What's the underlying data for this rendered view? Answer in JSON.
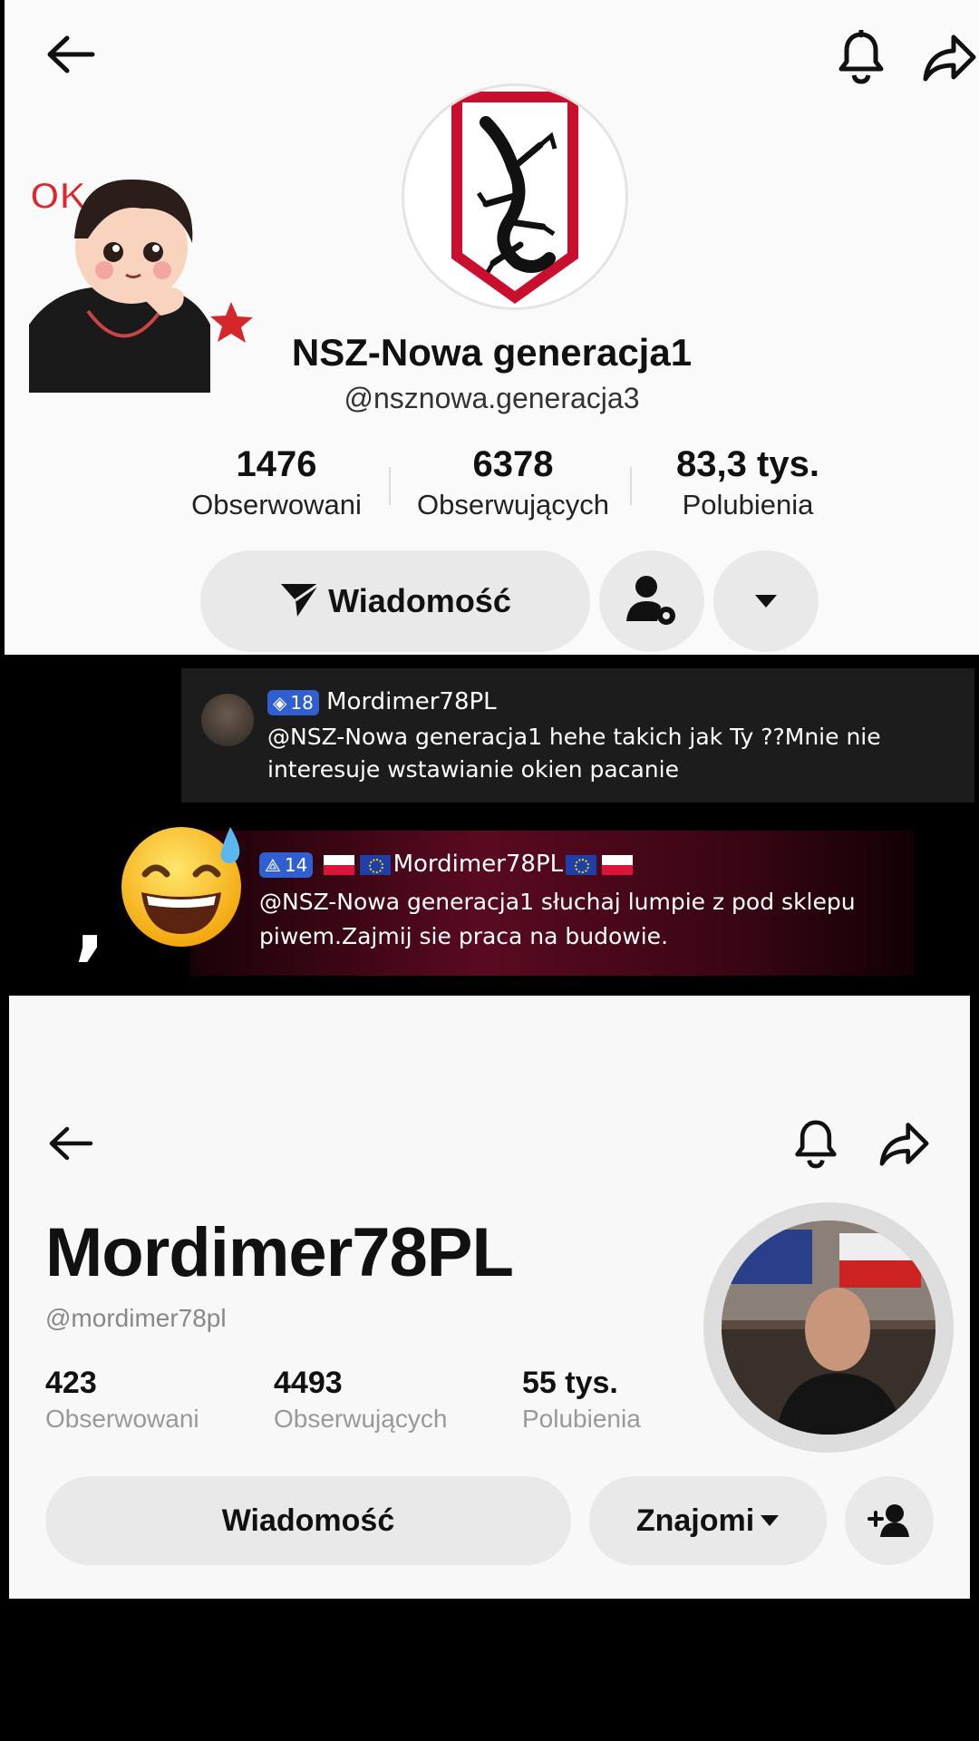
{
  "profile1": {
    "display_name": "NSZ-Nowa generacja1",
    "handle": "@nsznowa.generacja3",
    "stats": [
      {
        "value": "1476",
        "label": "Obserwowani"
      },
      {
        "value": "6378",
        "label": "Obserwujących"
      },
      {
        "value": "83,3 tys.",
        "label": "Polubienia"
      }
    ],
    "message_button": "Wiadomość",
    "sticker_text": "OK"
  },
  "comments": [
    {
      "badge_level": "18",
      "author": "Mordimer78PL",
      "text_line1": "@NSZ-Nowa generacja1 hehe takich jak Ty ??Mnie nie",
      "text_line2": "interesuje wstawianie okien pacanie"
    },
    {
      "badge_level": "14",
      "author": "Mordimer78PL",
      "text_line1": "@NSZ-Nowa generacja1 słuchaj lumpie z pod sklepu",
      "text_line2": "piwem.Zajmij sie praca na budowie.",
      "emoji": "😅",
      "comma": ","
    }
  ],
  "profile2": {
    "display_name": "Mordimer78PL",
    "handle": "@mordimer78pl",
    "stats": [
      {
        "value": "423",
        "label": "Obserwowani"
      },
      {
        "value": "4493",
        "label": "Obserwujących"
      },
      {
        "value": "55 tys.",
        "label": "Polubienia"
      }
    ],
    "message_button": "Wiadomość",
    "friends_button": "Znajomi"
  },
  "colors": {
    "badge": "#2f5fd0",
    "logo_red": "#c8102e",
    "pill": "#e9e9e9"
  }
}
